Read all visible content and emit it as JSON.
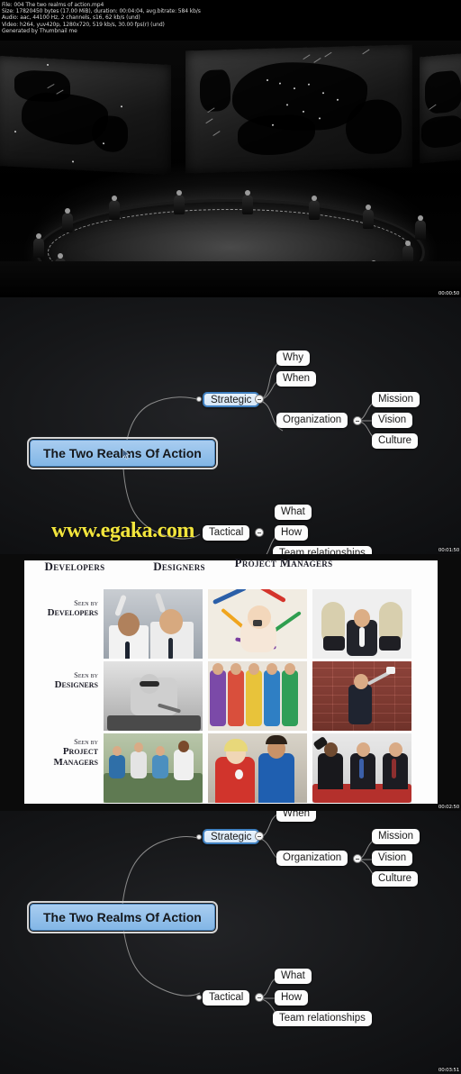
{
  "metadata": {
    "lines": [
      "File: 004 The two realms of action.mp4",
      "Size: 17820450 bytes (17.00 MiB), duration: 00:04:04, avg.bitrate: 584 kb/s",
      "Audio: aac, 44100 Hz, 2 channels, s16, 62 kb/s (und)",
      "Video: h264, yuv420p, 1280x720, 519 kb/s, 30.00 fps(r) (und)",
      "Generated by Thumbnail me"
    ],
    "file_name": "004 The two realms of action.mp4",
    "size_bytes": "17820450 bytes",
    "size_human": "17.00 MiB",
    "duration": "00:04:04",
    "avg_bitrate": "584 kb/s",
    "audio_codec": "aac",
    "audio_sample_rate": "44100 Hz",
    "audio_channels": "2 channels",
    "audio_format": "s16",
    "audio_bitrate": "62 kb/s",
    "video_codec": "h264",
    "video_pixfmt": "yuv420p",
    "video_resolution": "1280x720",
    "video_bitrate": "519 kb/s",
    "video_fps": "30.00 fps(r)",
    "generator": "Generated by Thumbnail me"
  },
  "frames": [
    {
      "index": 1,
      "timestamp": "00:00:50",
      "kind": "war-room-photo",
      "description": "Black and white war room scene with large illuminated world maps and a circular conference table"
    },
    {
      "index": 2,
      "timestamp": "00:01:50",
      "kind": "mindmap",
      "timestamp_visible": "00:01:50"
    },
    {
      "index": 3,
      "timestamp": "00:02:50",
      "kind": "meme-grid"
    },
    {
      "index": 4,
      "timestamp": "00:03:51",
      "kind": "mindmap"
    }
  ],
  "mindmap": {
    "center": "The Two Realms Of Action",
    "branches": [
      {
        "label": "Strategic",
        "children": [
          {
            "label": "Why",
            "children": []
          },
          {
            "label": "When",
            "children": []
          },
          {
            "label": "Organization",
            "children": [
              {
                "label": "Mission"
              },
              {
                "label": "Vision"
              },
              {
                "label": "Culture"
              }
            ]
          }
        ]
      },
      {
        "label": "Tactical",
        "children": [
          {
            "label": "What"
          },
          {
            "label": "How"
          },
          {
            "label": "Team relationships"
          }
        ]
      }
    ],
    "selected_node": "Strategic",
    "colors": {
      "center_fill": "#8fc0ea",
      "center_border": "#4d83b8",
      "node_fill": "#fcfcfc",
      "node_text": "#1b1b1b",
      "canvas": "#17181a",
      "edge": "#8b8b8b"
    }
  },
  "watermark": {
    "text": "www.egaka.com",
    "color": "#f2e53c"
  },
  "meme": {
    "column_headers": [
      "Developers",
      "Designers",
      "Project Managers"
    ],
    "row_headers": [
      {
        "small": "Seen by",
        "main": "Developers"
      },
      {
        "small": "Seen by",
        "main": "Designers"
      },
      {
        "small": "Seen by",
        "main": "Project Managers"
      }
    ],
    "cells": [
      [
        "scientists-in-lab-coats",
        "baby-painting-on-canvas",
        "man-feet-on-desk-relaxing"
      ],
      [
        "man-soldering-electronics",
        "fashion-models-colorful",
        "man-painting-brick-wall"
      ],
      [
        "factory-workers-assembly",
        "workers-in-red-and-blue-overalls",
        "politicians-waving-in-suits"
      ]
    ]
  }
}
